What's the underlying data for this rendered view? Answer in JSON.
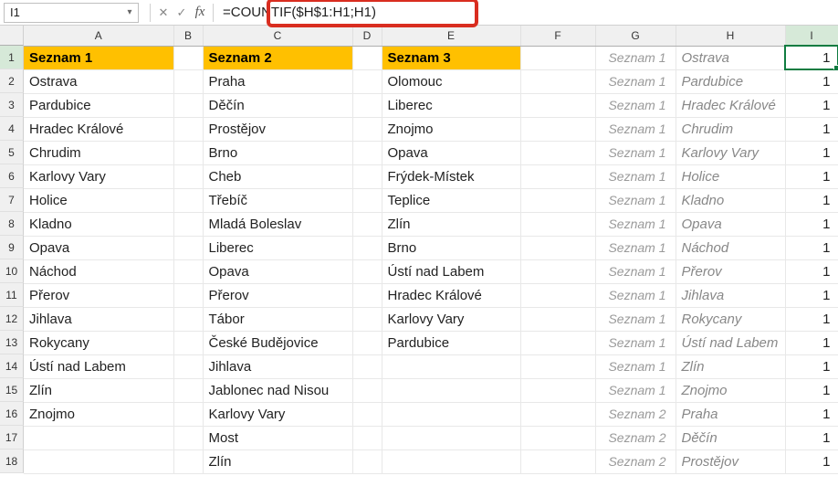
{
  "namebox": "I1",
  "formula": "=COUNTIF($H$1:H1;H1)",
  "fx_label": "fx",
  "col_letters": [
    "A",
    "B",
    "C",
    "D",
    "E",
    "F",
    "G",
    "H",
    "I"
  ],
  "row_numbers": [
    "1",
    "2",
    "3",
    "4",
    "5",
    "6",
    "7",
    "8",
    "9",
    "10",
    "11",
    "12",
    "13",
    "14",
    "15",
    "16",
    "17",
    "18"
  ],
  "hdr": {
    "s1": "Seznam 1",
    "s2": "Seznam 2",
    "s3": "Seznam 3"
  },
  "a": [
    "Ostrava",
    "Pardubice",
    "Hradec Králové",
    "Chrudim",
    "Karlovy Vary",
    "Holice",
    "Kladno",
    "Opava",
    "Náchod",
    "Přerov",
    "Jihlava",
    "Rokycany",
    "Ústí nad Labem",
    "Zlín",
    "Znojmo",
    "",
    ""
  ],
  "c": [
    "Praha",
    "Děčín",
    "Prostějov",
    "Brno",
    "Cheb",
    "Třebíč",
    "Mladá Boleslav",
    "Liberec",
    "Opava",
    "Přerov",
    "Tábor",
    "České Budějovice",
    "Jihlava",
    "Jablonec nad Nisou",
    "Karlovy Vary",
    "Most",
    "Zlín"
  ],
  "e": [
    "Olomouc",
    "Liberec",
    "Znojmo",
    "Opava",
    "Frýdek-Místek",
    "Teplice",
    "Zlín",
    "Brno",
    "Ústí nad Labem",
    "Hradec Králové",
    "Karlovy Vary",
    "Pardubice",
    "",
    "",
    "",
    "",
    ""
  ],
  "g": [
    "Seznam 1",
    "Seznam 1",
    "Seznam 1",
    "Seznam 1",
    "Seznam 1",
    "Seznam 1",
    "Seznam 1",
    "Seznam 1",
    "Seznam 1",
    "Seznam 1",
    "Seznam 1",
    "Seznam 1",
    "Seznam 1",
    "Seznam 1",
    "Seznam 1",
    "Seznam 2",
    "Seznam 2",
    "Seznam 2"
  ],
  "h": [
    "Ostrava",
    "Pardubice",
    "Hradec Králové",
    "Chrudim",
    "Karlovy Vary",
    "Holice",
    "Kladno",
    "Opava",
    "Náchod",
    "Přerov",
    "Jihlava",
    "Rokycany",
    "Ústí nad Labem",
    "Zlín",
    "Znojmo",
    "Praha",
    "Děčín",
    "Prostějov"
  ],
  "i": [
    "1",
    "1",
    "1",
    "1",
    "1",
    "1",
    "1",
    "1",
    "1",
    "1",
    "1",
    "1",
    "1",
    "1",
    "1",
    "1",
    "1",
    "1"
  ],
  "chart_data": {
    "type": "table",
    "title": "Spreadsheet with COUNTIF formula",
    "columns": [
      "A",
      "C",
      "E",
      "G",
      "H",
      "I"
    ],
    "rows": [
      [
        "Seznam 1",
        "Seznam 2",
        "Seznam 3",
        "Seznam 1",
        "Ostrava",
        "1"
      ],
      [
        "Ostrava",
        "Praha",
        "Olomouc",
        "Seznam 1",
        "Pardubice",
        "1"
      ],
      [
        "Pardubice",
        "Děčín",
        "Liberec",
        "Seznam 1",
        "Hradec Králové",
        "1"
      ],
      [
        "Hradec Králové",
        "Prostějov",
        "Znojmo",
        "Seznam 1",
        "Chrudim",
        "1"
      ],
      [
        "Chrudim",
        "Brno",
        "Opava",
        "Seznam 1",
        "Karlovy Vary",
        "1"
      ],
      [
        "Karlovy Vary",
        "Cheb",
        "Frýdek-Místek",
        "Seznam 1",
        "Holice",
        "1"
      ],
      [
        "Holice",
        "Třebíč",
        "Teplice",
        "Seznam 1",
        "Kladno",
        "1"
      ],
      [
        "Kladno",
        "Mladá Boleslav",
        "Zlín",
        "Seznam 1",
        "Opava",
        "1"
      ],
      [
        "Opava",
        "Liberec",
        "Brno",
        "Seznam 1",
        "Náchod",
        "1"
      ],
      [
        "Náchod",
        "Opava",
        "Ústí nad Labem",
        "Seznam 1",
        "Přerov",
        "1"
      ],
      [
        "Přerov",
        "Přerov",
        "Hradec Králové",
        "Seznam 1",
        "Jihlava",
        "1"
      ],
      [
        "Jihlava",
        "Tábor",
        "Karlovy Vary",
        "Seznam 1",
        "Rokycany",
        "1"
      ],
      [
        "Rokycany",
        "České Budějovice",
        "Pardubice",
        "Seznam 1",
        "Ústí nad Labem",
        "1"
      ],
      [
        "Ústí nad Labem",
        "Jihlava",
        "",
        "Seznam 1",
        "Zlín",
        "1"
      ],
      [
        "Zlín",
        "Jablonec nad Nisou",
        "",
        "Seznam 1",
        "Znojmo",
        "1"
      ],
      [
        "Znojmo",
        "Karlovy Vary",
        "",
        "Seznam 2",
        "Praha",
        "1"
      ],
      [
        "",
        "Most",
        "",
        "Seznam 2",
        "Děčín",
        "1"
      ],
      [
        "",
        "Zlín",
        "",
        "Seznam 2",
        "Prostějov",
        "1"
      ]
    ],
    "formula_cell": "I1",
    "formula": "=COUNTIF($H$1:H1;H1)"
  }
}
